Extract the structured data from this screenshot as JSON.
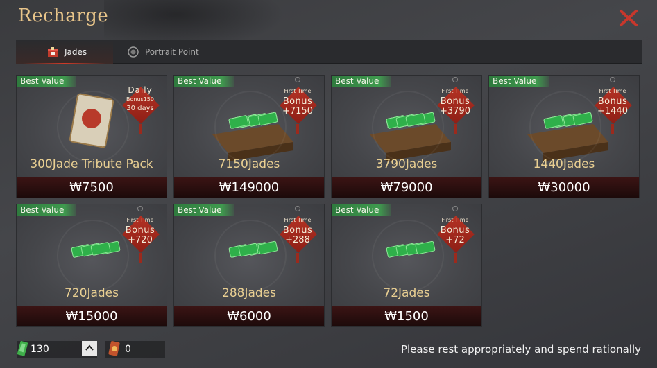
{
  "header": {
    "title": "Recharge"
  },
  "tabs": [
    {
      "label": "Jades",
      "active": true
    },
    {
      "label": "Portrait Point",
      "active": false
    }
  ],
  "currency_symbol": "₩",
  "products": [
    {
      "ribbon": "Best Value",
      "name": "300Jade Tribute Pack",
      "price": "₩7500",
      "badge_type": "daily",
      "daily_label": "Daily",
      "daily_sub": "Bonus150",
      "daily_days": "30 days"
    },
    {
      "ribbon": "Best Value",
      "name": "7150Jades",
      "price": "₩149000",
      "badge_type": "bonus",
      "first_time": "First Time",
      "bonus_label": "Bonus",
      "bonus_amount": "+7150"
    },
    {
      "ribbon": "Best Value",
      "name": "3790Jades",
      "price": "₩79000",
      "badge_type": "bonus",
      "first_time": "First Time",
      "bonus_label": "Bonus",
      "bonus_amount": "+3790"
    },
    {
      "ribbon": "Best Value",
      "name": "1440Jades",
      "price": "₩30000",
      "badge_type": "bonus",
      "first_time": "First Time",
      "bonus_label": "Bonus",
      "bonus_amount": "+1440"
    },
    {
      "ribbon": "Best Value",
      "name": "720Jades",
      "price": "₩15000",
      "badge_type": "bonus",
      "first_time": "First Time",
      "bonus_label": "Bonus",
      "bonus_amount": "+720"
    },
    {
      "ribbon": "Best Value",
      "name": "288Jades",
      "price": "₩6000",
      "badge_type": "bonus",
      "first_time": "First Time",
      "bonus_label": "Bonus",
      "bonus_amount": "+288"
    },
    {
      "ribbon": "Best Value",
      "name": "72Jades",
      "price": "₩1500",
      "badge_type": "bonus",
      "first_time": "First Time",
      "bonus_label": "Bonus",
      "bonus_amount": "+72"
    }
  ],
  "footer": {
    "jade_balance": "130",
    "coupon_balance": "0",
    "notice": "Please rest appropriately and spend rationally"
  },
  "colors": {
    "title": "#e8c58a",
    "ribbon": "#3f9a4e",
    "bonus_tag": "#b43224",
    "close": "#c8372c",
    "price_bar": "#1c0a0a"
  },
  "icons": {
    "close": "close-icon",
    "jades_tab": "jade-chest-icon",
    "portrait_tab": "portrait-badge-icon",
    "jade": "jade-icon",
    "coupon": "coupon-icon",
    "up": "chevron-up-icon"
  }
}
